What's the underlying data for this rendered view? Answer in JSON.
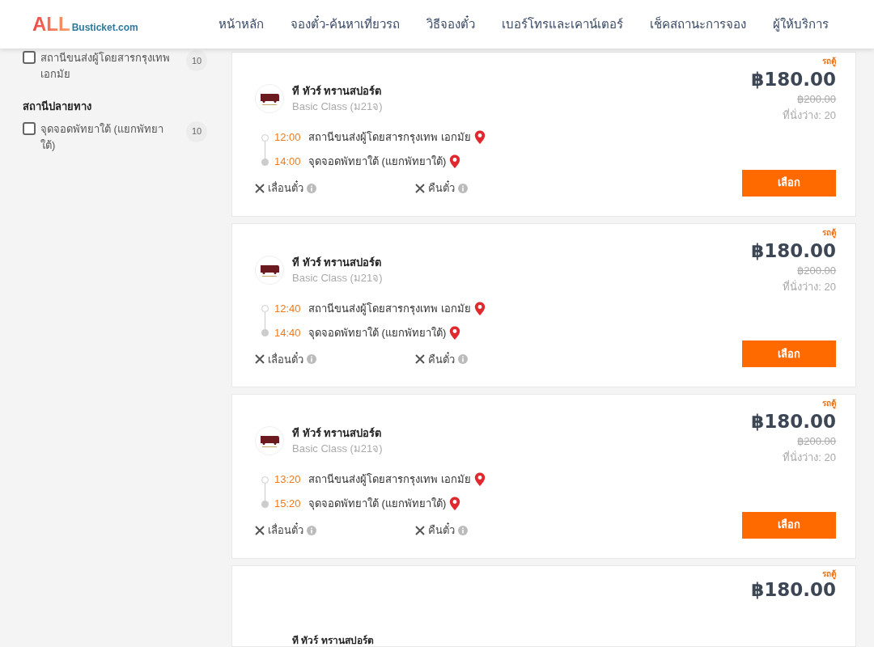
{
  "header": {
    "logo_big": "ALL",
    "logo_small": "Busticket.com",
    "nav": [
      {
        "label": "หน้าหลัก"
      },
      {
        "label": "จองตั๋ว-ค้นหาเที่ยวรถ"
      },
      {
        "label": "วิธีจองตั๋ว"
      },
      {
        "label": "เบอร์โทรและเคาน์เตอร์"
      },
      {
        "label": "เช็คสถานะการจอง"
      },
      {
        "label": "ผู้ให้บริการ"
      }
    ]
  },
  "sidebar": {
    "sections": [
      {
        "items": [
          {
            "label": "สถานีขนส่งผู้โดยสารกรุงเทพ เอกมัย",
            "count": "10",
            "checked": false
          }
        ]
      },
      {
        "title": "สถานีปลายทาง",
        "items": [
          {
            "label": "จุดจอดพัทยาใต้ (แยกพัทยาใต้)",
            "count": "10",
            "checked": false
          }
        ]
      }
    ]
  },
  "trips": [
    {
      "badge": "รถตู้",
      "operator": "ที ทัวร์ ทรานสปอร์ต",
      "class": "Basic Class (ม21จ)",
      "price": "฿180.00",
      "old_price": "฿200.00",
      "seats": "ที่นั่งว่าง: 20",
      "depart_time": "12:00",
      "depart_place": "สถานีขนส่งผู้โดยสารกรุงเทพ เอกมัย",
      "arrive_time": "14:00",
      "arrive_place": "จุดจอดพัทยาใต้ (แยกพัทยาใต้)",
      "policies": [
        "เลื่อนตั๋ว",
        "คืนตั๋ว"
      ],
      "button": "เลือก"
    },
    {
      "badge": "รถตู้",
      "operator": "ที ทัวร์ ทรานสปอร์ต",
      "class": "Basic Class (ม21จ)",
      "price": "฿180.00",
      "old_price": "฿200.00",
      "seats": "ที่นั่งว่าง: 20",
      "depart_time": "12:40",
      "depart_place": "สถานีขนส่งผู้โดยสารกรุงเทพ เอกมัย",
      "arrive_time": "14:40",
      "arrive_place": "จุดจอดพัทยาใต้ (แยกพัทยาใต้)",
      "policies": [
        "เลื่อนตั๋ว",
        "คืนตั๋ว"
      ],
      "button": "เลือก"
    },
    {
      "badge": "รถตู้",
      "operator": "ที ทัวร์ ทรานสปอร์ต",
      "class": "Basic Class (ม21จ)",
      "price": "฿180.00",
      "old_price": "฿200.00",
      "seats": "ที่นั่งว่าง: 20",
      "depart_time": "13:20",
      "depart_place": "สถานีขนส่งผู้โดยสารกรุงเทพ เอกมัย",
      "arrive_time": "15:20",
      "arrive_place": "จุดจอดพัทยาใต้ (แยกพัทยาใต้)",
      "policies": [
        "เลื่อนตั๋ว",
        "คืนตั๋ว"
      ],
      "button": "เลือก"
    },
    {
      "badge": "รถตู้",
      "operator": "ที ทัวร์ ทรานสปอร์ต",
      "price": "฿180.00"
    }
  ]
}
